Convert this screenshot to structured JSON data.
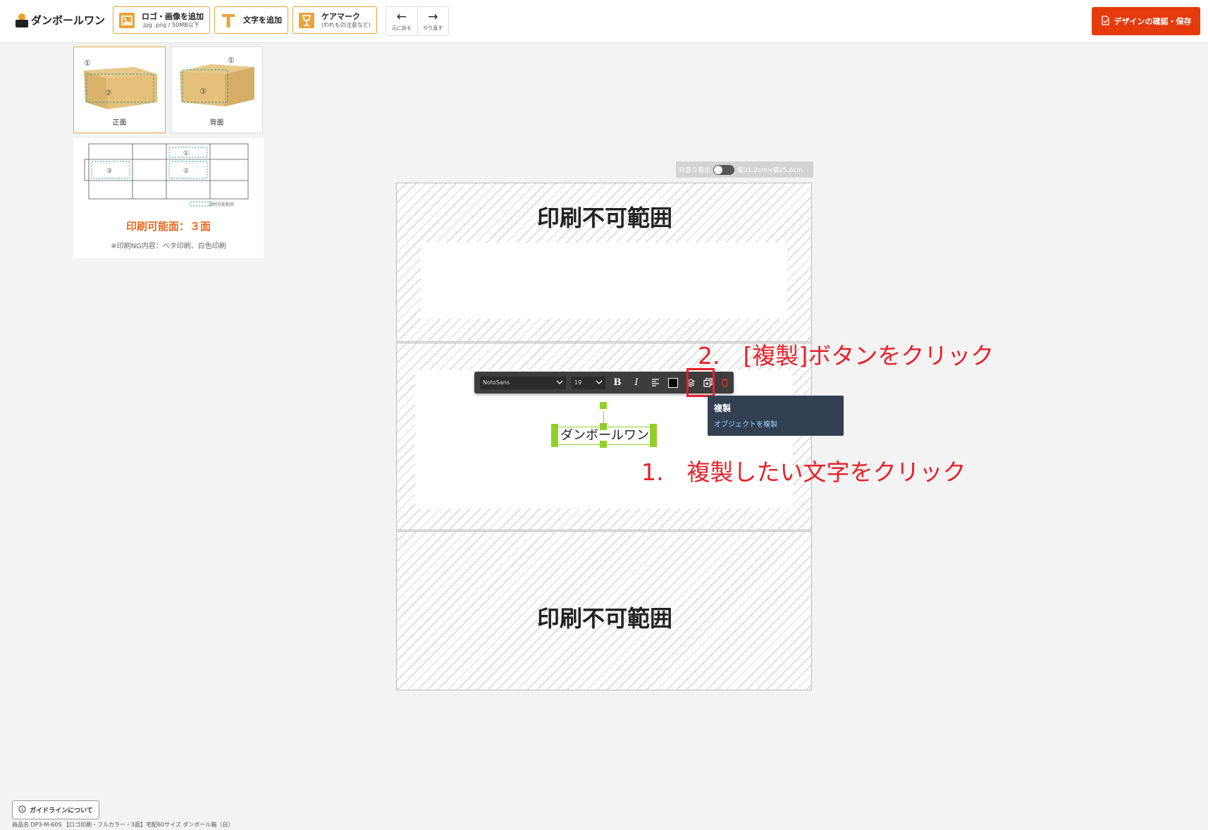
{
  "header": {
    "logo_text": "ダンボールワン",
    "add_image": {
      "title": "ロゴ・画像を追加",
      "sub": ".jpg .png / 50MB以下"
    },
    "add_text": {
      "title": "文字を追加"
    },
    "care_mark": {
      "title": "ケアマーク",
      "sub": "(われもの注意など)"
    },
    "undo_label": "元に戻る",
    "redo_label": "やり直す",
    "save_label": "デザインの確認・保存"
  },
  "sidebar": {
    "thumbs": [
      {
        "label": "正面",
        "active": true
      },
      {
        "label": "背面",
        "active": false
      }
    ],
    "legend_label": "印刷可能範囲",
    "print_faces": "印刷可能面：３面",
    "ng_note": "※印刷NG内容：ベタ印刷、白色印刷"
  },
  "canvas": {
    "ruler_label": "目盛り表示",
    "size_label": "縦31.2cm×横25.6cm",
    "no_print_label": "印刷不可範囲",
    "selected_text": "ダンボールワン"
  },
  "text_toolbar": {
    "font": "NotoSans",
    "size": "19",
    "bold": "B",
    "italic": "I",
    "text_color": "#000000"
  },
  "tooltip": {
    "title": "複製",
    "description": "オブジェクトを複製"
  },
  "annotations": {
    "step2": "2.　[複製]ボタンをクリック",
    "step1": "1.　複製したい文字をクリック"
  },
  "footer": {
    "guide_label": "ガイドラインについて",
    "product_name": "商品名 DP3-M-60S 【ロゴ印刷・フルカラー・3面】宅配60サイズ ダンボール箱（白）"
  },
  "colors": {
    "accent": "#e8a33c",
    "save": "#e53a0c",
    "annotation": "#e8202a",
    "selection": "#8fd12a",
    "tooltip_bg": "#324052"
  }
}
